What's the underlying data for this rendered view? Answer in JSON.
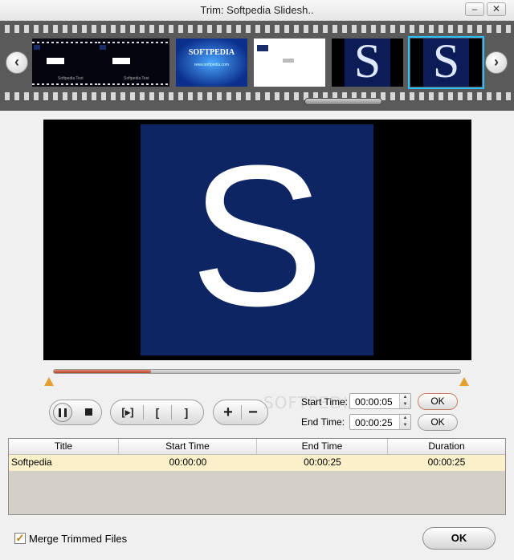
{
  "window": {
    "title": "Trim: Softpedia Slidesh..",
    "minimize_glyph": "–",
    "close_glyph": "✕"
  },
  "filmstrip": {
    "prev_glyph": "‹",
    "next_glyph": "›",
    "thumbnails": [
      {
        "caption": "Softpedia Test"
      },
      {
        "caption": "Softpedia Test"
      },
      {
        "caption": "SOFTPEDIA",
        "subcaption": "www.softpedia.com"
      },
      {
        "caption": ""
      },
      {
        "caption": "S"
      },
      {
        "caption": "S",
        "selected": true
      }
    ],
    "accent_color": "#29c2ff"
  },
  "preview": {
    "glyph": "S",
    "background_color": "#0e2564"
  },
  "timeline": {
    "progress": 0.24,
    "fill_color": "#b4452a",
    "marker_color": "#e3a030"
  },
  "controls": {
    "play_pause_icon": "pause-icon",
    "stop_icon": "stop-icon",
    "frame_step_label": "[▸]",
    "mark_in_label": "[",
    "mark_out_label": "]",
    "add_label": "+",
    "remove_label": "−"
  },
  "trim": {
    "start_label": "Start Time:",
    "start_value": "00:00:05",
    "end_label": "End Time:",
    "end_value": "00:00:25",
    "ok_label": "OK"
  },
  "watermark": "SOFTPEDIA",
  "table": {
    "columns": [
      "Title",
      "Start Time",
      "End Time",
      "Duration"
    ],
    "rows": [
      {
        "title": "Softpedia",
        "start": "00:00:00",
        "end": "00:00:25",
        "duration": "00:00:25"
      }
    ],
    "row_highlight": "#fbf0c9"
  },
  "footer": {
    "merge_label": "Merge Trimmed Files",
    "merge_checked": true,
    "check_glyph": "✓",
    "ok_label": "OK"
  }
}
